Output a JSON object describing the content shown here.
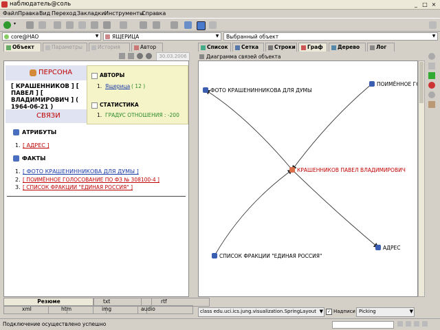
{
  "window": {
    "title": "наблюдатель@соль",
    "min": "_",
    "max": "□",
    "close": "×"
  },
  "menu": [
    "Файл",
    "Правка",
    "Вид",
    "Переход",
    "Закладки",
    "Инструменты",
    "Справка"
  ],
  "address": {
    "store": "core@HAO",
    "category": "ЯЩЕРИЦА",
    "selected": "Выбранный объект"
  },
  "left_tabs": [
    "Объект",
    "Параметры",
    "История",
    "Автор"
  ],
  "left_date": "30.03.2006",
  "right_tabs": [
    "Список",
    "Сетка",
    "Строки",
    "Граф",
    "Дерево",
    "Лог"
  ],
  "graph_title": "Диаграмма связей объекта",
  "object": {
    "persona": "ПЕРСОНА",
    "name": "[ КРАШЕННИКОВ ] [ ПАВЕЛ ] [ ВЛАДИМИРОВИЧ ] ( 1964-06-21 )",
    "links": "СВЯЗИ",
    "authors_label": "АВТОРЫ",
    "author_num": "1.",
    "author_name": "Ящерица",
    "author_count": "( 12 )",
    "stats_label": "СТАТИСТИКА",
    "stats_num": "1.",
    "stats_value": "ГРАДУС ОТНОШЕНИЯ : -200",
    "attrs_label": "АТРИБУТЫ",
    "attrs": [
      {
        "num": "1.",
        "text": "[ АДРЕС ]"
      }
    ],
    "facts_label": "ФАКТЫ",
    "facts": [
      {
        "num": "1.",
        "text": "[ ФОТО КРАШЕНИННИКОВА ДЛЯ ДУМЫ ]"
      },
      {
        "num": "2.",
        "text": "[ ПОИМЁННОЕ ГОЛОСОВАНИЕ ПО ФЗ № 308100-4 ]"
      },
      {
        "num": "3.",
        "text": "[ СПИСОК ФРАКЦИИ \"ЕДИНАЯ РОССИЯ\" ]"
      }
    ]
  },
  "graph": {
    "nodes": [
      {
        "id": "center",
        "label": "КРАШЕННИКОВ ПАВЕЛ ВЛАДИМИРОВИЧ"
      },
      {
        "id": "photo",
        "label": "ФОТО КРАШЕНИННИКОВА ДЛЯ ДУМЫ"
      },
      {
        "id": "vote",
        "label": "ПОИМЁННОЕ ГО"
      },
      {
        "id": "list",
        "label": "СПИСОК ФРАКЦИИ \"ЕДИНАЯ РОССИЯ\""
      },
      {
        "id": "addr",
        "label": "АДРЕС"
      }
    ],
    "edges": [
      {
        "from": "center",
        "to": "photo"
      },
      {
        "from": "vote",
        "to": "center"
      },
      {
        "from": "list",
        "to": "center"
      },
      {
        "from": "center",
        "to": "addr"
      }
    ]
  },
  "left_bottom_tabs": {
    "row1": [
      "Резюме",
      "txt",
      "rtf"
    ],
    "row2": [
      "xml",
      "htm",
      "img",
      "audio"
    ]
  },
  "graph_controls": {
    "layout": "class edu.uci.ics.jung.visualization.SpringLayout",
    "labels_check": "Надписи",
    "mode": "Picking"
  },
  "status": "Подключение осуществлено успешно",
  "colors": {
    "accent_red": "#c00000",
    "link_blue": "#1a3aa8",
    "stats_green": "#2a8a2a",
    "info_bg": "#f5f3c8",
    "header_bg": "#dfe3f2"
  }
}
